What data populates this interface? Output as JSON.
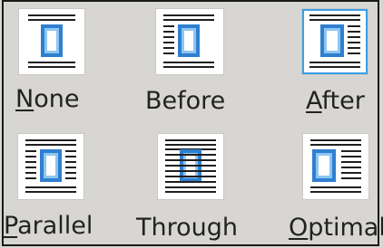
{
  "wrap_options": [
    {
      "id": "none",
      "mnemonic": "N",
      "rest": "one",
      "selected": false
    },
    {
      "id": "before",
      "mnemonic": "",
      "rest": "Before",
      "selected": false
    },
    {
      "id": "after",
      "mnemonic": "A",
      "rest": "fter",
      "selected": true
    },
    {
      "id": "parallel",
      "mnemonic": "P",
      "rest": "arallel",
      "selected": false
    },
    {
      "id": "through",
      "mnemonic": "",
      "rest": "Through",
      "selected": false
    },
    {
      "id": "optimal",
      "mnemonic": "O",
      "rest": "ptimal",
      "selected": false
    }
  ],
  "colors": {
    "background": "#d8d6d3",
    "line": "#1f1f1f",
    "frame_blue": "#2f7fd0",
    "frame_light": "#8cc6f2",
    "selection": "#3aa0e6"
  },
  "icons": [
    "wrap-none-icon",
    "wrap-before-icon",
    "wrap-after-icon",
    "wrap-parallel-icon",
    "wrap-through-icon",
    "wrap-optimal-icon"
  ]
}
